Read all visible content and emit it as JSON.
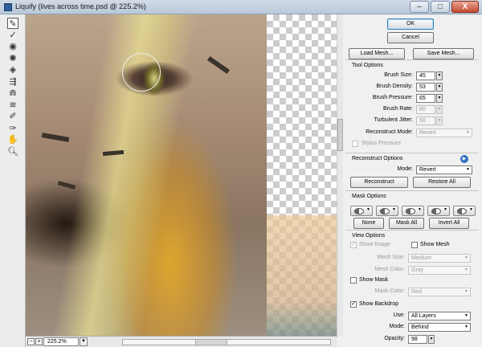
{
  "window": {
    "title": "Liquify (lives across time.psd @ 225.2%)",
    "min_label": "–",
    "max_label": "□",
    "close_label": "X"
  },
  "toolbox": {
    "tools": [
      {
        "name": "forward-warp-tool-icon",
        "glyph": "✎"
      },
      {
        "name": "reconstruct-tool-icon",
        "glyph": "✓"
      },
      {
        "name": "twirl-tool-icon",
        "glyph": "◉"
      },
      {
        "name": "pucker-tool-icon",
        "glyph": "✺"
      },
      {
        "name": "bloat-tool-icon",
        "glyph": "◈"
      },
      {
        "name": "push-left-tool-icon",
        "glyph": "⇶"
      },
      {
        "name": "mirror-tool-icon",
        "glyph": "⋒"
      },
      {
        "name": "turbulence-tool-icon",
        "glyph": "≋"
      },
      {
        "name": "freeze-mask-tool-icon",
        "glyph": "✐"
      },
      {
        "name": "thaw-mask-tool-icon",
        "glyph": "✑"
      },
      {
        "name": "hand-tool-icon",
        "glyph": "✋"
      },
      {
        "name": "zoom-tool-icon",
        "glyph": "🔍︎"
      }
    ]
  },
  "bottom": {
    "zoom_value": "225.2%",
    "zoom_out": "−",
    "zoom_in": "+",
    "zoom_dropdown": "▼"
  },
  "buttons": {
    "ok": "OK",
    "cancel": "Cancel",
    "load_mesh": "Load Mesh...",
    "save_mesh": "Save Mesh..."
  },
  "tool_options": {
    "section": "Tool Options",
    "brush_size_label": "Brush Size:",
    "brush_size": "45",
    "brush_density_label": "Brush Density:",
    "brush_density": "53",
    "brush_pressure_label": "Brush Pressure:",
    "brush_pressure": "65",
    "brush_rate_label": "Brush Rate:",
    "brush_rate": "80",
    "turbulent_jitter_label": "Turbulent Jitter:",
    "turbulent_jitter": "50",
    "reconstruct_mode_label": "Reconstruct Mode:",
    "reconstruct_mode": "Revert",
    "stylus_pressure_label": "Stylus Pressure",
    "stylus_pressure_checked": false,
    "dropdown_glyph": "▼"
  },
  "reconstruct_options": {
    "section": "Reconstruct Options",
    "info_glyph": "▶",
    "mode_label": "Mode:",
    "mode": "Revert",
    "reconstruct_button": "Reconstruct",
    "restore_all_button": "Restore All"
  },
  "mask_options": {
    "section": "Mask Options",
    "replace_arrow": "▼",
    "add_arrow": "▼",
    "subtract_arrow": "▼",
    "intersect_arrow": "▼",
    "invert_arrow": "▼",
    "none_button": "None",
    "mask_all_button": "Mask All",
    "invert_all_button": "Invert All"
  },
  "view_options": {
    "section": "View Options",
    "show_image_label": "Show Image",
    "show_image_checked": true,
    "show_mesh_label": "Show Mesh",
    "show_mesh_checked": false,
    "mesh_size_label": "Mesh Size:",
    "mesh_size": "Medium",
    "mesh_color_label": "Mesh Color:",
    "mesh_color": "Gray",
    "show_mask_label": "Show Mask",
    "show_mask_checked": false,
    "mask_color_label": "Mask Color:",
    "mask_color": "Red",
    "show_backdrop_label": "Show Backdrop",
    "show_backdrop_checked": true,
    "use_label": "Use:",
    "use": "All Layers",
    "backdrop_mode_label": "Mode:",
    "backdrop_mode": "Behind",
    "opacity_label": "Opacity:",
    "opacity": "98"
  },
  "check_mark": "✓"
}
